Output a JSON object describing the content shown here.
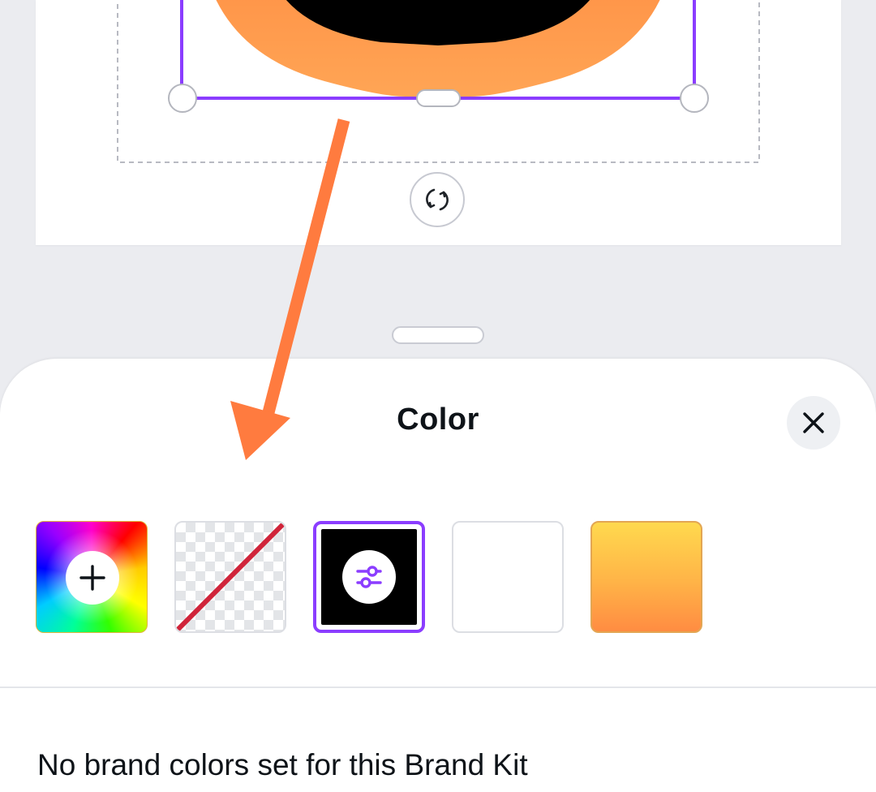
{
  "panel": {
    "title": "Color",
    "swatches": [
      {
        "id": "add-color",
        "icon": "plus-icon"
      },
      {
        "id": "transparent",
        "icon": "no-color-slash"
      },
      {
        "id": "black",
        "color": "#000000",
        "selected": true,
        "icon": "sliders-adjust-icon"
      },
      {
        "id": "white",
        "color": "#ffffff"
      },
      {
        "id": "orange-gradient",
        "colors": [
          "#ffd94e",
          "#ff8c42"
        ]
      }
    ],
    "brand_kit_message": "No brand colors set for this Brand Kit"
  },
  "canvas": {
    "shape_colors": {
      "ring": "#ff9a4f",
      "inner": "#000000"
    },
    "selection_color": "#8b3dff"
  },
  "annotation": {
    "arrow_color": "#ff7b3f"
  },
  "colors": {
    "accent": "#8b3dff",
    "background": "#ebecf0"
  }
}
